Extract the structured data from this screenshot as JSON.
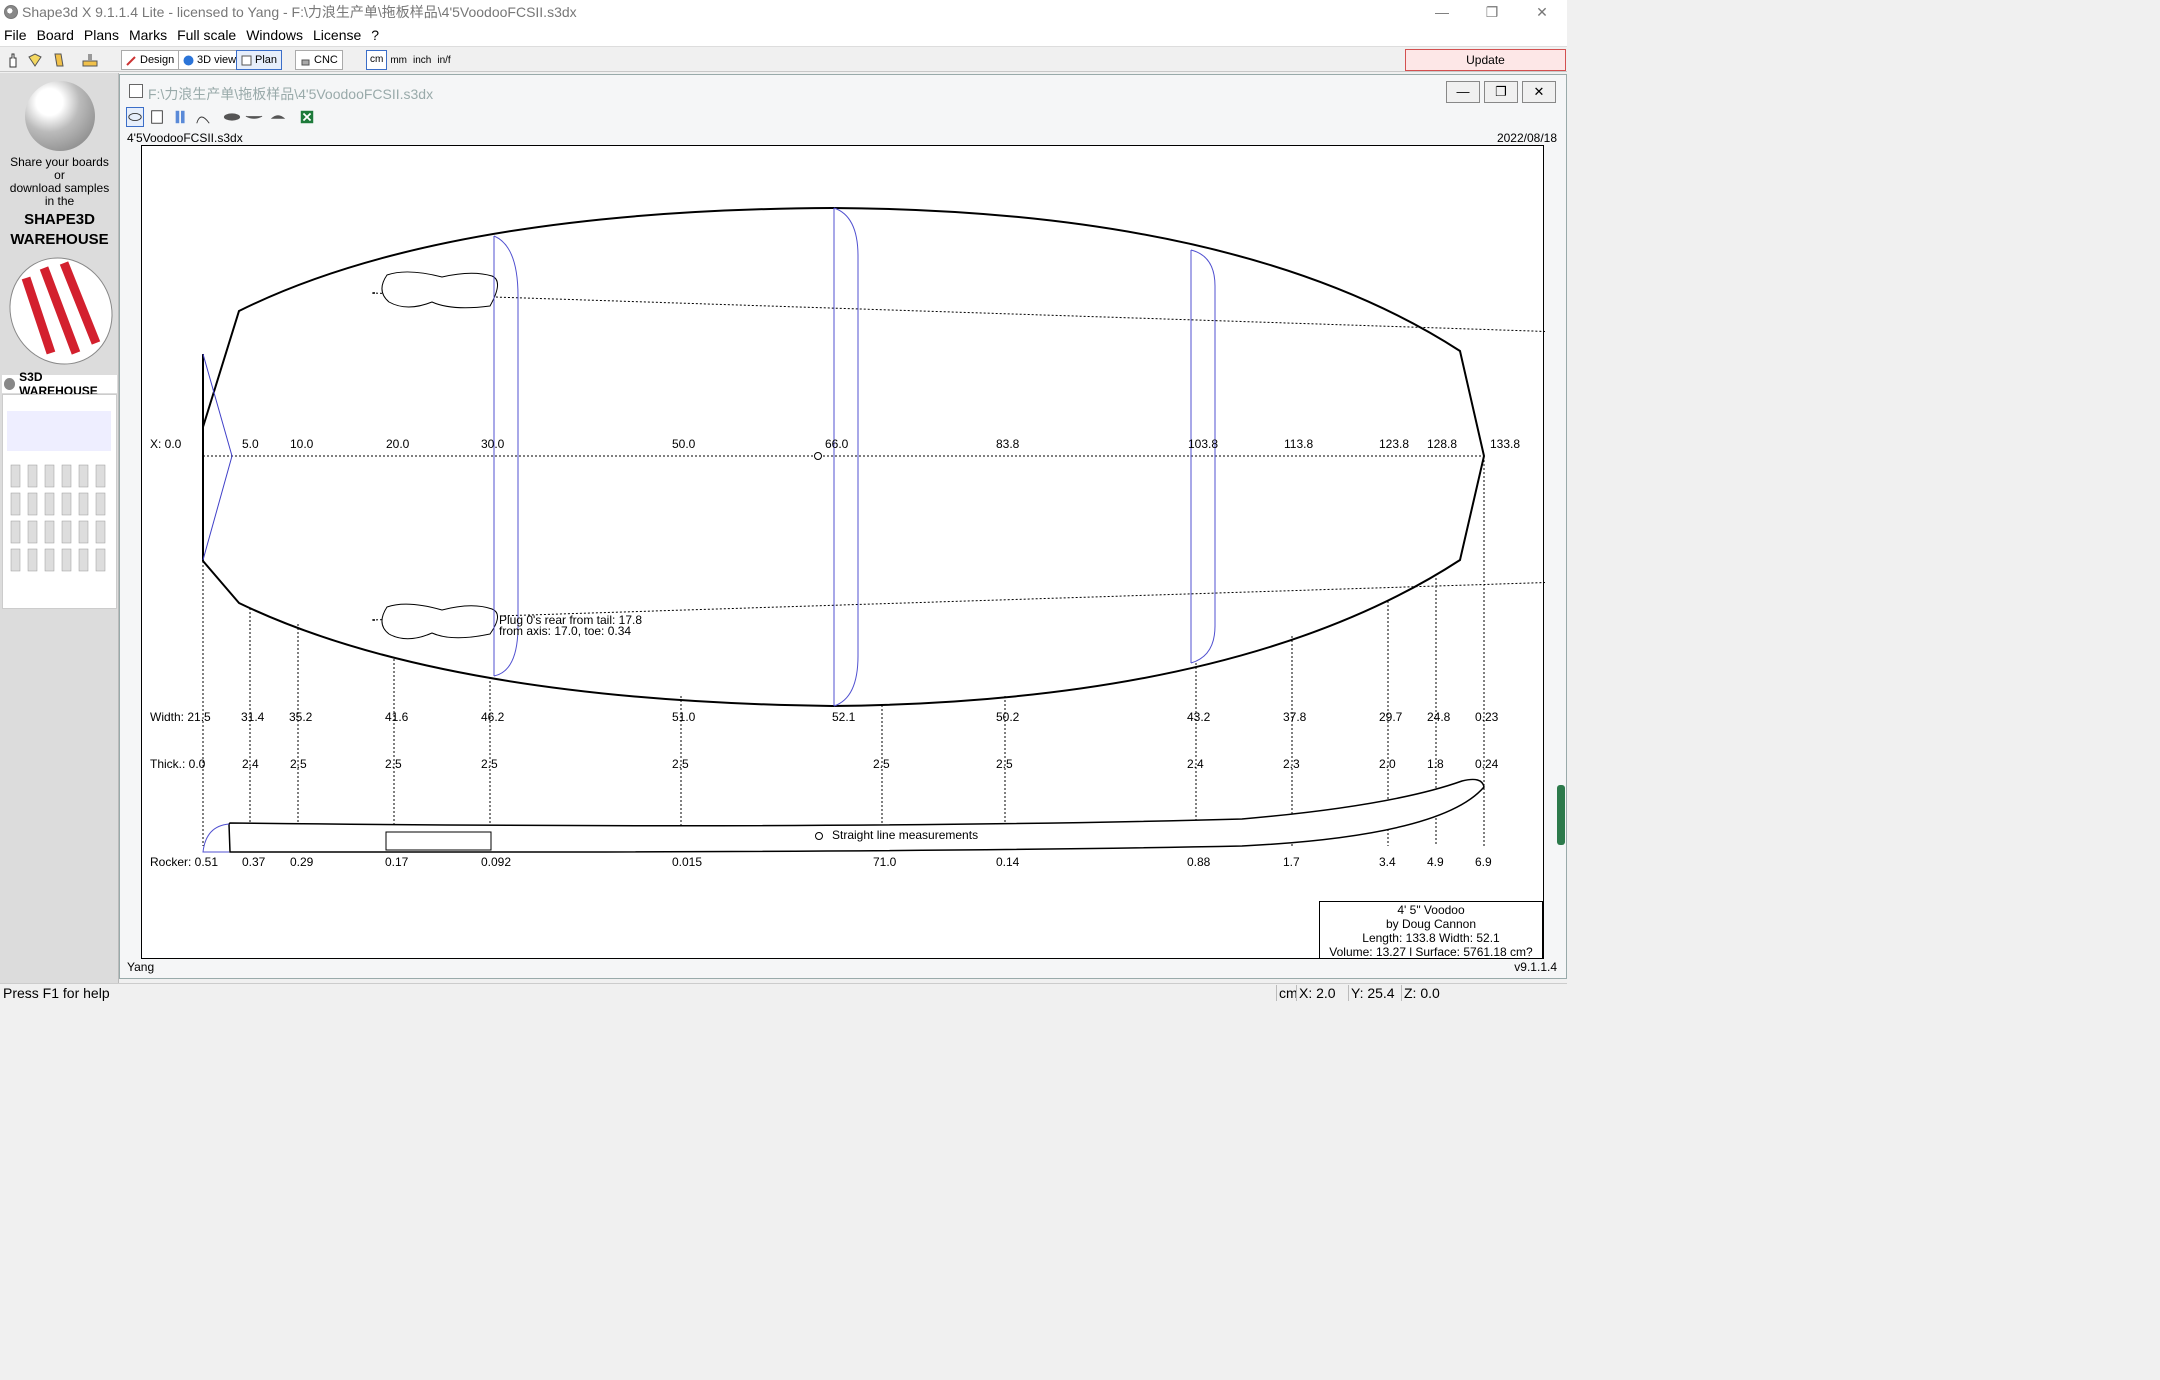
{
  "app": {
    "title": "Shape3d X 9.1.1.4 Lite - licensed to Yang - F:\\力浪生产单\\拖板样品\\4'5VoodooFCSII.s3dx",
    "window_controls": [
      "—",
      "❐",
      "✕"
    ]
  },
  "menu": [
    "File",
    "Board",
    "Plans",
    "Marks",
    "Full scale",
    "Windows",
    "License",
    "?"
  ],
  "toolbar": {
    "modes": [
      {
        "label": "Design",
        "icon": "design-icon"
      },
      {
        "label": "3D view",
        "icon": "globe-icon"
      },
      {
        "label": "Plan",
        "icon": "plan-icon",
        "active": true
      },
      {
        "label": "CNC",
        "icon": "cnc-icon"
      }
    ],
    "units": [
      "cm",
      "mm",
      "inch",
      "in/f"
    ],
    "selected_unit": "cm",
    "update_label": "Update"
  },
  "sidebar": {
    "promo_text": "Share your boards\nor\ndownload samples\nin the",
    "promo_brand": "SHAPE3D\nWAREHOUSE",
    "banner": "S3D WAREHOUSE"
  },
  "document": {
    "title": "F:\\力浪生产单\\拖板样品\\4'5VoodooFCSII.s3dx",
    "filename": "4'5VoodooFCSII.s3dx",
    "date": "2022/08/18",
    "user": "Yang",
    "version": "v9.1.1.4"
  },
  "plan": {
    "x_prefix": "X: 0.0",
    "x_marks": [
      "5.0",
      "10.0",
      "20.0",
      "30.0",
      "50.0",
      "66.0",
      "83.8",
      "103.8",
      "113.8",
      "123.8",
      "128.8",
      "133.8"
    ],
    "width_prefix": "Width: 21.5",
    "widths": [
      "31.4",
      "35.2",
      "41.6",
      "46.2",
      "51.0",
      "52.1",
      "50.2",
      "43.2",
      "37.8",
      "29.7",
      "24.8",
      "0.23"
    ],
    "thick_prefix": "Thick.: 0.0",
    "thicknesses": [
      "2.4",
      "2.5",
      "2.5",
      "2.5",
      "2.5",
      "2.5",
      "2.5",
      "2.4",
      "2.3",
      "2.0",
      "1.8",
      "0.24"
    ],
    "rocker_prefix": "Rocker: 0.51",
    "rockers": [
      "0.37",
      "0.29",
      "0.17",
      "0.092",
      "0.015",
      "71.0",
      "0.14",
      "0.88",
      "1.7",
      "3.4",
      "4.9",
      "6.9"
    ],
    "plug_note_1": "Plug 0's rear from tail: 17.8",
    "plug_note_2": "from axis: 17.0, toe: 0.34",
    "straight_note": "Straight line measurements"
  },
  "info_box": {
    "name": "4' 5\" Voodoo",
    "author": "by Doug Cannon",
    "dims": "Length: 133.8 Width: 52.1",
    "volume": "Volume: 13.27 l  Surface: 5761.18 cm?"
  },
  "status": {
    "help": "Press F1 for help",
    "unit": "cm",
    "x": "X: 2.0",
    "y": "Y: 25.4",
    "z": "Z: 0.0"
  }
}
